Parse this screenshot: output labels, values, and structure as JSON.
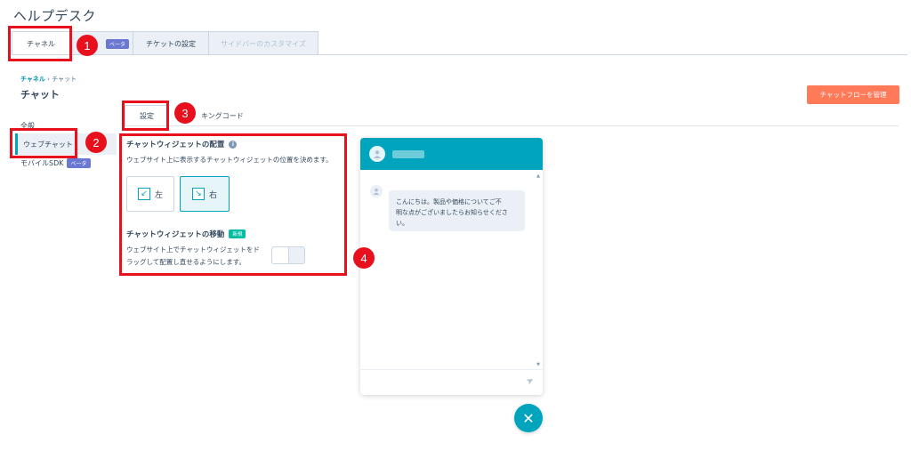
{
  "app": {
    "title": "ヘルプデスク"
  },
  "top_tabs": [
    {
      "label": "チャネル",
      "active": true,
      "disabled": false
    },
    {
      "label": "",
      "badge": "ベータ",
      "active": false,
      "disabled": false
    },
    {
      "label": "チケットの設定",
      "active": false,
      "disabled": false
    },
    {
      "label": "サイドバーのカスタマイズ",
      "active": false,
      "disabled": true
    }
  ],
  "breadcrumb": {
    "parent": "チャネル",
    "separator": "›",
    "current": "チャット"
  },
  "page": {
    "title": "チャット",
    "manage_button": "チャットフローを管理"
  },
  "sidenav": {
    "section_label": "全般",
    "items": [
      {
        "label": "ウェブチャット",
        "active": true
      },
      {
        "label": "モバイルSDK",
        "badge": "ベータ",
        "active": false
      }
    ]
  },
  "settings_tabs": [
    {
      "label": "設定",
      "active": true
    },
    {
      "label": "キングコード",
      "active": false
    }
  ],
  "placement": {
    "title": "チャットウィジェットの配置",
    "info_icon": "i",
    "description": "ウェブサイト上に表示するチャットウィジェットの位置を決めます。",
    "options": [
      {
        "label": "左",
        "arrow": "↙",
        "selected": false
      },
      {
        "label": "右",
        "arrow": "↘",
        "selected": true
      }
    ]
  },
  "movement": {
    "title": "チャットウィジェットの移動",
    "badge": "新規",
    "description_line1": "ウェブサイト上でチャットウィジェットをド",
    "description_line2": "ラッグして配置し直せるようにします。",
    "enabled": false
  },
  "chat_preview": {
    "message_line1": "こんにちは。製品や価格についてご不",
    "message_line2": "明な点がございましたらお知らせくださ",
    "message_line3": "い。",
    "send_icon": "➤",
    "close_icon": "✕"
  },
  "callouts": [
    "1",
    "2",
    "3",
    "4"
  ],
  "colors": {
    "accent": "#00a4bd",
    "cta": "#ff7a59",
    "annotation": "#e8101c",
    "beta": "#6a78d1",
    "new": "#00bda5"
  }
}
